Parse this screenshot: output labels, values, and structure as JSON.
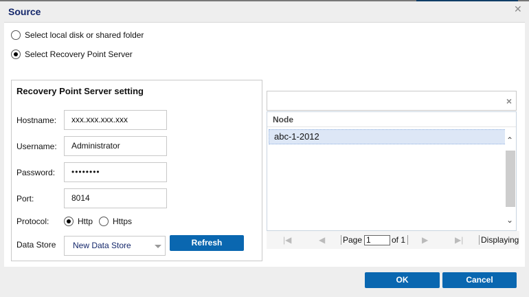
{
  "dialog": {
    "title": "Source",
    "close_icon": "close-icon"
  },
  "source_options": [
    {
      "label": "Select local disk or shared folder",
      "selected": false
    },
    {
      "label": "Select Recovery Point Server",
      "selected": true
    }
  ],
  "rps": {
    "title": "Recovery Point Server setting",
    "hostname_label": "Hostname:",
    "hostname": "xxx.xxx.xxx.xxx",
    "username_label": "Username:",
    "username": "Administrator",
    "password_label": "Password:",
    "password": "••••••••",
    "port_label": "Port:",
    "port": "8014",
    "protocol_label": "Protocol:",
    "protocols": [
      {
        "label": "Http",
        "selected": true
      },
      {
        "label": "Https",
        "selected": false
      }
    ],
    "datastore_label": "Data Store",
    "datastore": "New Data Store",
    "refresh": "Refresh"
  },
  "nodes": {
    "search": "",
    "header": "Node",
    "rows": [
      "abc-1-2012"
    ],
    "pager": {
      "page_label": "Page",
      "page": "1",
      "of": "of 1",
      "displaying": "Displaying"
    }
  },
  "footer": {
    "ok": "OK",
    "cancel": "Cancel"
  }
}
